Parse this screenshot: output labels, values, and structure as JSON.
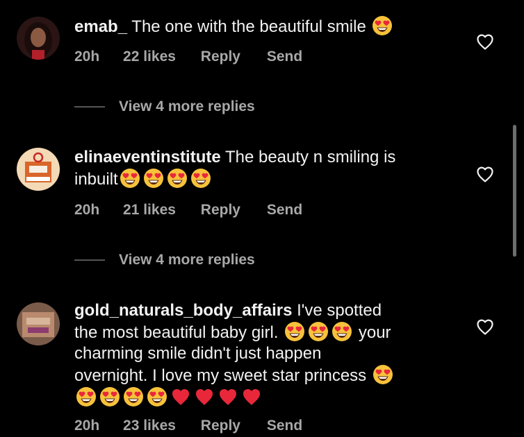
{
  "comments": [
    {
      "username": "emab_",
      "text_parts": [
        " The one with the beautiful smile "
      ],
      "time": "20h",
      "likes": "22 likes",
      "reply": "Reply",
      "send": "Send"
    },
    {
      "username": "elinaeventinstitute",
      "text_parts": [
        " The beauty n smiling is",
        "inbuilt"
      ],
      "time": "20h",
      "likes": "21 likes",
      "reply": "Reply",
      "send": "Send"
    },
    {
      "username": "gold_naturals_body_affairs",
      "text_parts": [
        " I've spotted",
        "the most beautiful baby girl. ",
        " your",
        "charming smile didn't just happen",
        "overnight. I love my sweet star princess "
      ],
      "time": "20h",
      "likes": "23 likes",
      "reply": "Reply",
      "send": "Send"
    }
  ],
  "view_replies": [
    "View 4 more replies",
    "View 4 more replies"
  ],
  "colors": {
    "background": "#000000",
    "text": "#f2f2f2",
    "meta": "#a8a8a8",
    "emoji_face": "#f7c23b",
    "heart_red": "#e8283a"
  },
  "icons": [
    "heart-eyes-emoji",
    "red-heart-emoji",
    "heart-outline-icon"
  ]
}
